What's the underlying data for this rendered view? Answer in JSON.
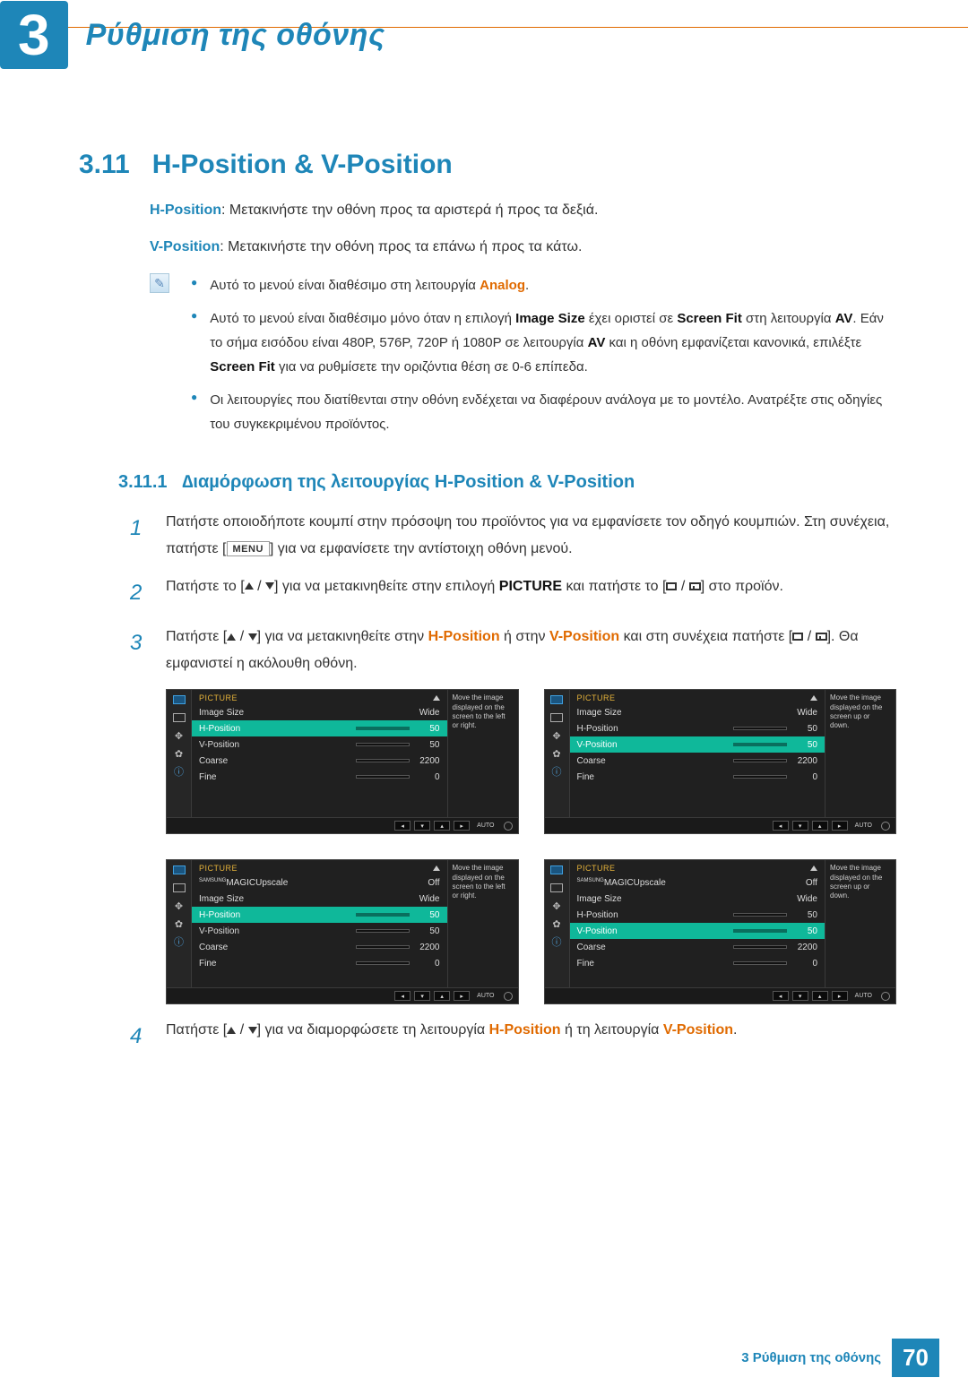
{
  "header": {
    "chapter_number": "3",
    "chapter_title": "Ρύθμιση της οθόνης"
  },
  "section": {
    "number": "3.11",
    "title": "H-Position & V-Position"
  },
  "intro": {
    "h_label": "H-Position",
    "h_desc": ": Μετακινήστε την οθόνη προς τα αριστερά ή προς τα δεξιά.",
    "v_label": "V-Position",
    "v_desc": ": Μετακινήστε την οθόνη προς τα επάνω ή προς τα κάτω."
  },
  "notes": [
    {
      "pre": "Αυτό το μενού είναι διαθέσιμο στη λειτουργία ",
      "orange1": "Analog",
      "post1": "."
    },
    {
      "pre": "Αυτό το μενού είναι διαθέσιμο μόνο όταν η επιλογή ",
      "b1": "Image Size",
      "mid1": " έχει οριστεί σε ",
      "b2": "Screen Fit",
      "mid2": " στη λειτουργία ",
      "b3": "AV",
      "mid3": ". Εάν το σήμα εισόδου είναι 480P, 576P, 720P ή 1080P σε λειτουργία ",
      "b4": "AV",
      "mid4": " και η οθόνη εμφανίζεται κανονικά, επιλέξτε ",
      "b5": "Screen Fit",
      "post": " για να ρυθμίσετε την οριζόντια θέση σε 0-6 επίπεδα."
    },
    {
      "pre": "Οι λειτουργίες που διατίθενται στην οθόνη ενδέχεται να διαφέρουν ανάλογα με το μοντέλο. Ανατρέξτε στις οδηγίες του συγκεκριμένου προϊόντος."
    }
  ],
  "subsection": {
    "number": "3.11.1",
    "title": "∆ιαµόρφωση της λειτουργίας H-Position & V-Position"
  },
  "steps": {
    "s1a": "Πατήστε οποιοδήποτε κουμπί στην πρόσοψη του προϊόντος για να εμφανίσετε τον οδηγό κουμπιών. Στη συνέχεια, πατήστε [",
    "menu": "MENU",
    "s1b": "] για να εμφανίσετε την αντίστοιχη οθόνη μενού.",
    "s2a": "Πατήστε το [",
    "s2b": "] για να μετακινηθείτε στην επιλογή ",
    "picture": "PICTURE",
    "s2c": " και πατήστε το [",
    "s2d": "] στο προϊόν.",
    "s3a": "Πατήστε [",
    "s3b": "] για να μετακινηθείτε στην ",
    "hpos": "H-Position",
    "s3c": " ή στην ",
    "vpos": "V-Position",
    "s3d": " και στη συνέχεια πατήστε [",
    "s3e": "]. Θα εμφανιστεί η ακόλουθη οθόνη.",
    "s4a": "Πατήστε [",
    "s4b": "] για να διαμορφώσετε τη λειτουργία ",
    "s4c": " ή τη λειτουργία ",
    "s4d": "."
  },
  "osd": {
    "head": "PICTURE",
    "image_size": "Image Size",
    "image_size_val": "Wide",
    "hpos": "H-Position",
    "vpos": "V-Position",
    "coarse": "Coarse",
    "fine": "Fine",
    "magic_pre": "SAMSUNG",
    "magic": "MAGIC",
    "magic_post": "Upscale",
    "magic_val": "Off",
    "v50": "50",
    "v2200": "2200",
    "v0": "0",
    "help_h": "Move the image displayed on the screen to the left or right.",
    "help_v": "Move the image displayed on the screen up or down.",
    "auto": "AUTO"
  },
  "footer": {
    "text": "3 Ρύθμιση της οθόνης",
    "page": "70"
  },
  "chart_data": {
    "type": "table",
    "title": "PICTURE OSD menu values",
    "rows": [
      {
        "item": "Image Size",
        "value": "Wide"
      },
      {
        "item": "H-Position",
        "value": 50
      },
      {
        "item": "V-Position",
        "value": 50
      },
      {
        "item": "Coarse",
        "value": 2200
      },
      {
        "item": "Fine",
        "value": 0
      },
      {
        "item": "SAMSUNG MAGIC Upscale",
        "value": "Off"
      }
    ]
  }
}
